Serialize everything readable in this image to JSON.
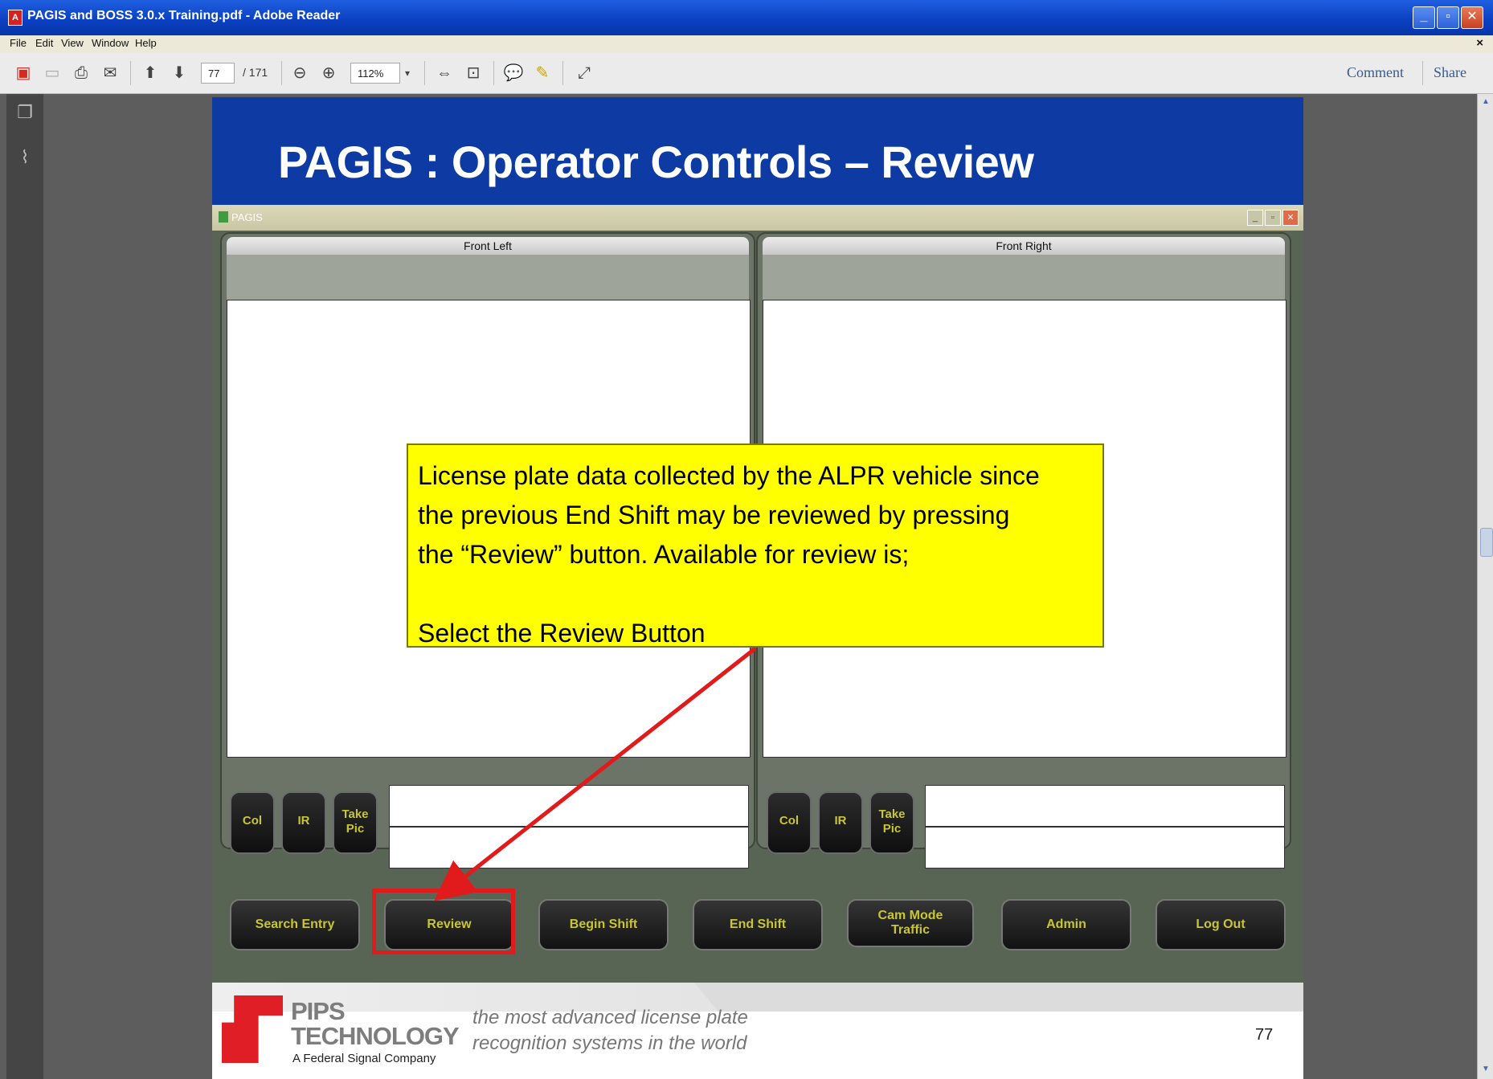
{
  "window": {
    "title": "PAGIS and BOSS 3.0.x Training.pdf - Adobe Reader",
    "app_icon_text": "A",
    "controls": [
      "minimize",
      "maximize",
      "close"
    ]
  },
  "menu": [
    "File",
    "Edit",
    "View",
    "Window",
    "Help"
  ],
  "menu_doc_close": "×",
  "toolbar": {
    "page_current": "77",
    "page_total": "/ 171",
    "zoom": "112%",
    "comment_label": "Comment",
    "share_label": "Share"
  },
  "slide": {
    "title": "PAGIS : Operator Controls – Review",
    "app_window_title": "PAGIS",
    "panels": [
      {
        "label": "Front Left",
        "buttons": [
          "Col",
          "IR",
          "Take Pic"
        ]
      },
      {
        "label": "Front Right",
        "buttons": [
          "Col",
          "IR",
          "Take Pic"
        ]
      }
    ],
    "commands": [
      "Search Entry",
      "Review",
      "Begin Shift",
      "End Shift",
      "Cam Mode Traffic",
      "Admin",
      "Log Out"
    ],
    "highlighted_command": "Review",
    "callout": {
      "lines": [
        "License plate data collected by the ALPR vehicle since",
        "the previous End Shift may be reviewed by pressing",
        "the “Review” button. Available for review is;",
        "",
        "Select the Review Button"
      ]
    },
    "footer": {
      "logo_line1": "PIPS",
      "logo_line2": "TECHNOLOGY",
      "logo_sub": "A Federal Signal Company",
      "tagline_line1": "the most advanced license plate",
      "tagline_line2": "recognition systems in the world",
      "page_number": "77"
    }
  },
  "colors": {
    "slide_header": "#0d3ba3",
    "callout": "#ffff00",
    "highlight": "#e11b1b",
    "button_text": "#c9c632"
  }
}
